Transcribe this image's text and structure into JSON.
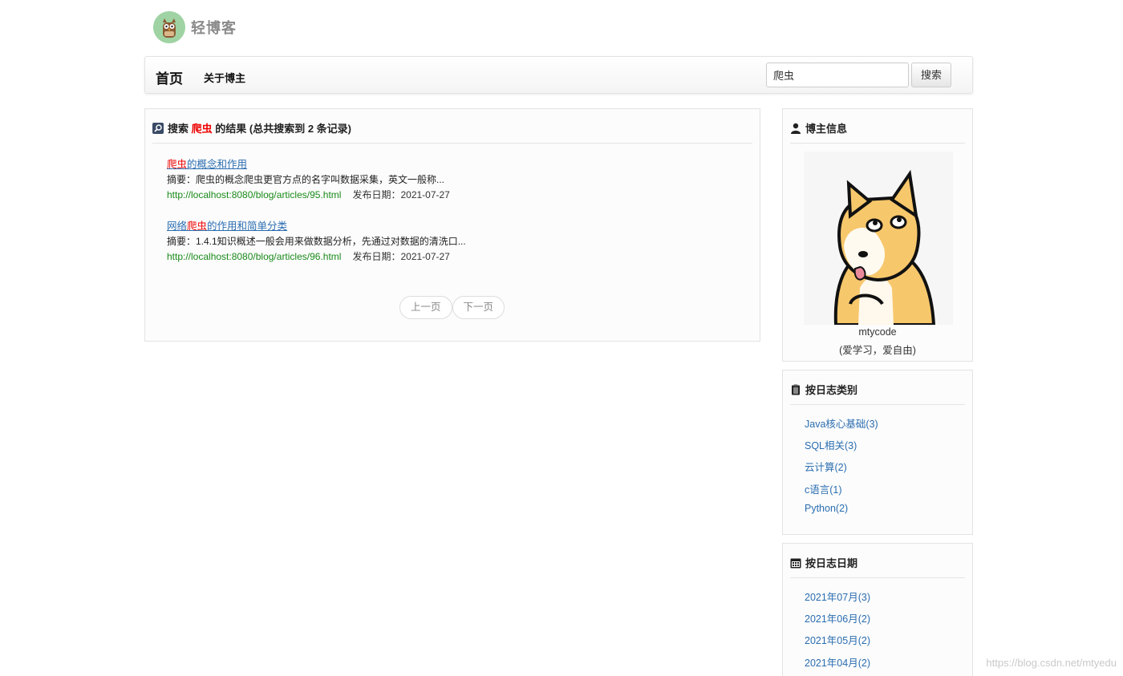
{
  "site": {
    "logo_text": "轻博客"
  },
  "nav": {
    "home": "首页",
    "about": "关于博主"
  },
  "search": {
    "value": "爬虫",
    "button": "搜索"
  },
  "results_panel": {
    "title_prefix": "搜索",
    "keyword": "爬虫",
    "title_suffix": "的结果 (总共搜索到 2 条记录)",
    "results": [
      {
        "title_pre": "",
        "title_kw": "爬虫",
        "title_post": "的概念和作用",
        "summary": "摘要：爬虫的概念爬虫更官方点的名字叫数据采集，英文一般称...",
        "url": "http://localhost:8080/blog/articles/95.html",
        "date": "发布日期：2021-07-27"
      },
      {
        "title_pre": "网络",
        "title_kw": "爬虫",
        "title_post": "的作用和简单分类",
        "summary": "摘要：1.4.1知识概述一般会用来做数据分析，先通过对数据的清洗口...",
        "url": "http://localhost:8080/blog/articles/96.html",
        "date": "发布日期：2021-07-27"
      }
    ],
    "pager": {
      "prev": "上一页",
      "next": "下一页"
    }
  },
  "blogger": {
    "title": "博主信息",
    "name": "mtycode",
    "motto": "(爱学习，爱自由)"
  },
  "categories": {
    "title": "按日志类别",
    "items": [
      "Java核心基础(3)",
      "SQL相关(3)",
      "云计算(2)",
      "c语言(1)",
      "Python(2)"
    ]
  },
  "dates": {
    "title": "按日志日期",
    "items": [
      "2021年07月(3)",
      "2021年06月(2)",
      "2021年05月(2)",
      "2021年04月(2)"
    ]
  },
  "watermark": "https://blog.csdn.net/mtyedu"
}
